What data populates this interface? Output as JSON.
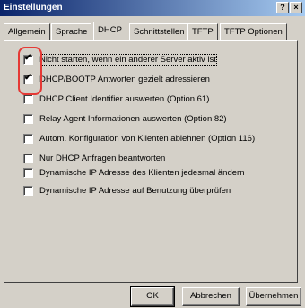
{
  "window": {
    "title": "Einstellungen",
    "help_label": "?",
    "close_label": "×"
  },
  "tabs": [
    {
      "label": "Allgemein"
    },
    {
      "label": "Sprache"
    },
    {
      "label": "DHCP"
    },
    {
      "label": "Schnittstellen"
    },
    {
      "label": "TFTP"
    },
    {
      "label": "TFTP Optionen"
    }
  ],
  "active_tab": "DHCP",
  "options": [
    {
      "label": "Nicht starten, wenn ein anderer Server aktiv ist",
      "checked": true
    },
    {
      "label": "DHCP/BOOTP Antworten gezielt adressieren",
      "checked": true
    },
    {
      "label": "DHCP Client Identifier auswerten (Option 61)",
      "checked": false
    },
    {
      "label": "Relay Agent Informationen auswerten (Option 82)",
      "checked": false
    },
    {
      "label": "Autom. Konfiguration von Klienten ablehnen (Option 116)",
      "checked": false
    },
    {
      "label": "Nur DHCP Anfragen beantworten",
      "checked": false
    },
    {
      "label": "Dynamische IP Adresse des Klienten jedesmal ändern",
      "checked": false
    },
    {
      "label": "Dynamische IP Adresse auf Benutzung überprüfen",
      "checked": false
    }
  ],
  "check_glyph": "✔",
  "buttons": {
    "ok": "OK",
    "cancel": "Abbrechen",
    "apply": "Übernehmen"
  },
  "colors": {
    "title_start": "#0a246a",
    "title_end": "#a6caf0",
    "highlight": "#e53935",
    "face": "#d4d0c8"
  }
}
